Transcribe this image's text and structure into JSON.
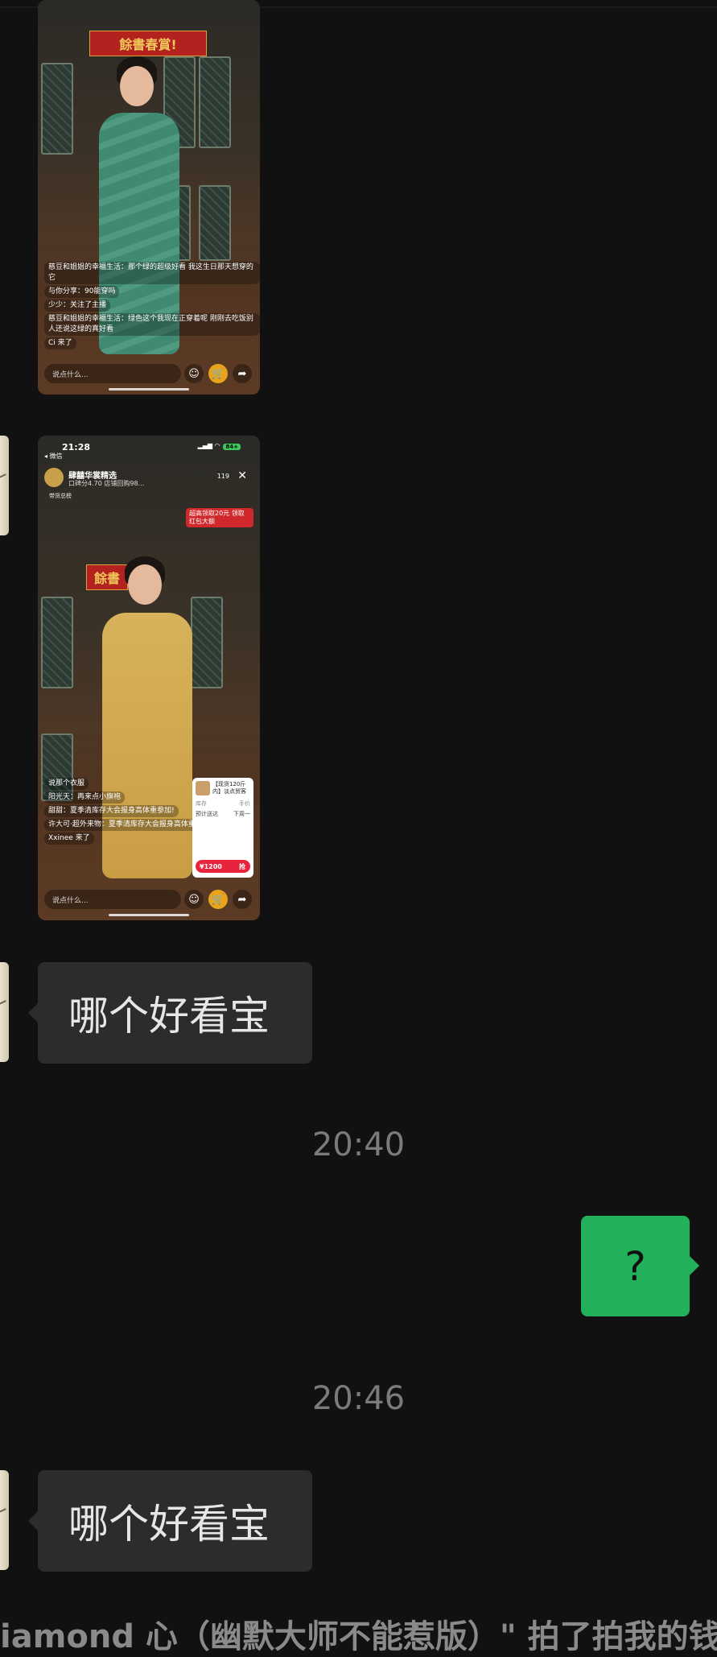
{
  "messages": [
    {
      "kind": "image",
      "screenshot": {
        "banner_text": "餘書春賞!",
        "comments": [
          "慈豆和姐姐的幸福生活：那个绿的超级好看 我这生日那天想穿的它",
          "与你分享：90能穿吗",
          "少少：关注了主播",
          "慈豆和姐姐的幸福生活：绿色这个我现在正穿着呢 刚刚去吃饭别人还说这绿的真好看",
          "Ci 来了"
        ],
        "input_placeholder": "说点什么..."
      }
    },
    {
      "kind": "image",
      "screenshot": {
        "status_time": "21:28",
        "back_label": "◂ 微信",
        "battery": "84+",
        "shop_name": "肆囍华裳精选",
        "shop_sub": "口碑分4.70  店铺回购98...",
        "viewers": "119",
        "rank_label": "带货总榜",
        "coupon_text": "超高领取20元 领取红包大额",
        "banner_text": "餘書",
        "comments": [
          "说那个衣服",
          "阳光天：再来点小旗袍",
          "甜甜：夏季清库存大会报身高体重参加!",
          "许大可·超外来物：夏季清库存大会报身高体重参加!",
          "Xxinee 来了"
        ],
        "input_placeholder": "说点什么...",
        "product": {
          "title": "【现货120斤内】淡点贸客",
          "meta_left": "库存",
          "meta_right": "手价",
          "meta2_left": "预计送达",
          "meta2_right": "下周一",
          "price": "¥1200",
          "buy": "抢"
        }
      }
    },
    {
      "kind": "text",
      "direction": "incoming",
      "text": "哪个好看宝"
    },
    {
      "kind": "timestamp",
      "text": "20:40"
    },
    {
      "kind": "text",
      "direction": "outgoing",
      "text": "?"
    },
    {
      "kind": "timestamp",
      "text": "20:46"
    },
    {
      "kind": "text",
      "direction": "incoming",
      "text": "哪个好看宝"
    }
  ],
  "footer_system_text": "iamond 心（幽默大师不能惹版）\" 拍了拍我的钱",
  "colors": {
    "background": "#111111",
    "incoming_bubble": "#2c2c2c",
    "outgoing_bubble": "#22b05a",
    "timestamp": "#7b7b7b"
  }
}
